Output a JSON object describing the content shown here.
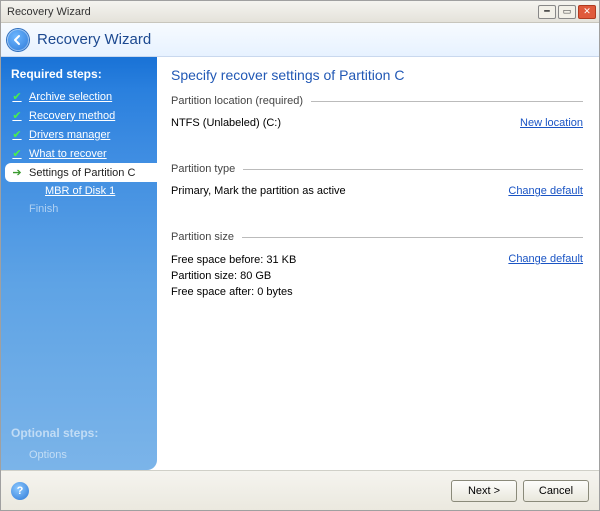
{
  "titlebar": {
    "title": "Recovery Wizard"
  },
  "header": {
    "title": "Recovery Wizard"
  },
  "sidebar": {
    "required_label": "Required steps:",
    "optional_label": "Optional steps:",
    "steps": [
      {
        "label": "Archive selection"
      },
      {
        "label": "Recovery method"
      },
      {
        "label": "Drivers manager"
      },
      {
        "label": "What to recover"
      },
      {
        "label": "Settings of Partition C"
      },
      {
        "label": "MBR of Disk 1"
      },
      {
        "label": "Finish"
      }
    ],
    "optional_steps": [
      {
        "label": "Options"
      }
    ]
  },
  "main": {
    "heading": "Specify recover settings of Partition C",
    "location": {
      "group_label": "Partition location (required)",
      "value": "NTFS (Unlabeled) (C:)",
      "link": "New location"
    },
    "type": {
      "group_label": "Partition type",
      "value": "Primary, Mark the partition as active",
      "link": "Change default"
    },
    "size": {
      "group_label": "Partition size",
      "free_before": "Free space before: 31 KB",
      "partition_size": "Partition size: 80 GB",
      "free_after": "Free space after: 0 bytes",
      "link": "Change default"
    }
  },
  "footer": {
    "next": "Next >",
    "cancel": "Cancel"
  }
}
